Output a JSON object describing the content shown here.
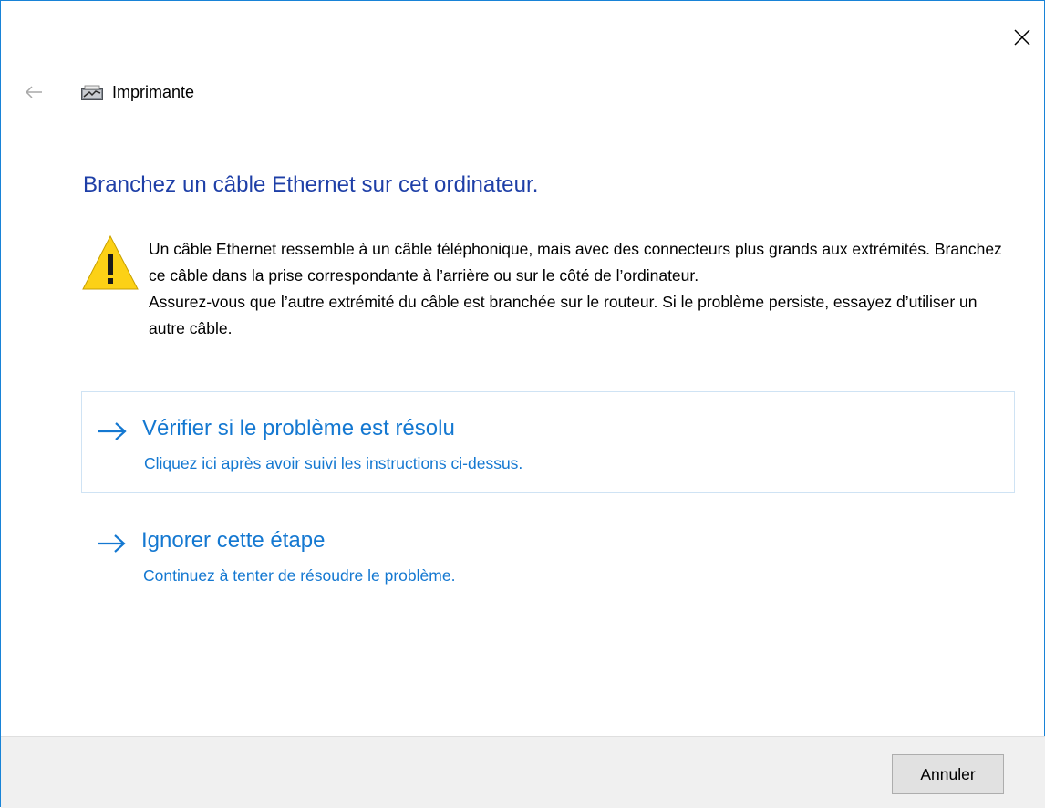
{
  "window": {
    "title": "Imprimante",
    "close_icon": "close-icon",
    "back_icon": "back-arrow-icon",
    "app_icon": "printer-network-icon"
  },
  "main": {
    "instruction": "Branchez un câble Ethernet sur cet ordinateur.",
    "warning_icon": "warning-icon",
    "paragraph_1": "Un câble Ethernet ressemble à un câble téléphonique, mais avec des connecteurs plus grands aux extrémités. Branchez ce câble dans la prise correspondante à l’arrière ou sur le côté de l’ordinateur.",
    "paragraph_2": "Assurez-vous que l’autre extrémité du câble est branchée sur le routeur. Si le problème persiste, essayez d’utiliser un autre câble."
  },
  "options": [
    {
      "heading": "Vérifier si le problème est résolu",
      "subtext": "Cliquez ici après avoir suivi les instructions ci-dessus.",
      "icon": "arrow-right-icon"
    },
    {
      "heading": "Ignorer cette étape",
      "subtext": "Continuez à tenter de résoudre le problème.",
      "icon": "arrow-right-icon"
    }
  ],
  "footer": {
    "cancel_label": "Annuler"
  },
  "colors": {
    "accent_border": "#1883d7",
    "instruction_text": "#1e3fa7",
    "link_text": "#1478d1",
    "warning_yellow": "#fcd116",
    "footer_bg": "#f0f0f0"
  }
}
